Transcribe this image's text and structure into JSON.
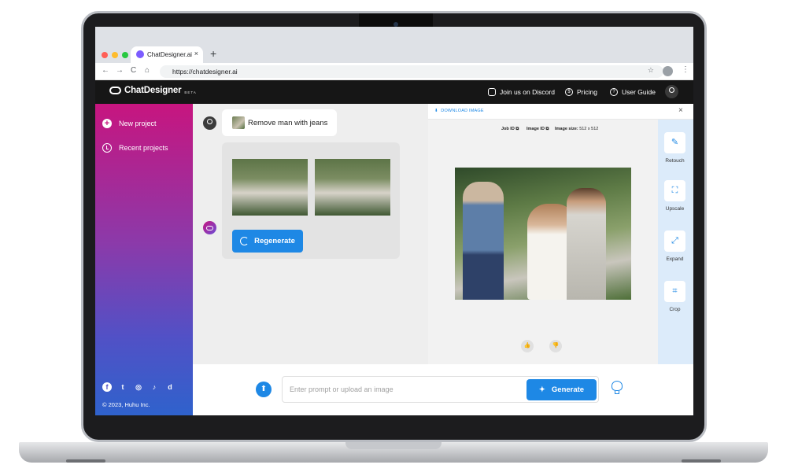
{
  "browser": {
    "tab_title": "ChatDesigner.ai",
    "tab_close": "×",
    "new_tab": "+",
    "url": "https://chatdesigner.ai",
    "back": "←",
    "forward": "→",
    "reload": "C",
    "home": "⌂",
    "bookmark": "☆",
    "menu": "⋮"
  },
  "header": {
    "brand": "ChatDesigner",
    "badge": "BETA",
    "discord": "Join us on Discord",
    "pricing": "Pricing",
    "user_guide": "User Guide",
    "pricing_icon": "$",
    "guide_icon": "?"
  },
  "sidebar": {
    "new_project": "New project",
    "new_project_icon": "+",
    "recent_projects": "Recent projects",
    "social": [
      {
        "name": "facebook",
        "glyph": "f"
      },
      {
        "name": "twitter",
        "glyph": "t"
      },
      {
        "name": "instagram",
        "glyph": "◎"
      },
      {
        "name": "tiktok",
        "glyph": "♪"
      },
      {
        "name": "discord",
        "glyph": "d"
      }
    ],
    "copyright": "© 2023, Huhu Inc."
  },
  "chat": {
    "prompt": "Remove man with jeans",
    "regenerate": "Regenerate"
  },
  "panel": {
    "download": "DOWNLOAD IMAGE",
    "download_icon": "⬇",
    "close": "×",
    "job_id_label": "Job ID",
    "image_id_label": "Image ID",
    "image_size_label": "Image size:",
    "image_size_value": "512 x 512",
    "copy_icon": "⧉",
    "like": "👍",
    "dislike": "👎"
  },
  "tools": [
    {
      "label": "Retouch",
      "glyph": "✎"
    },
    {
      "label": "Upscale",
      "glyph": "⛶"
    },
    {
      "label": "Expand",
      "glyph": "⤢"
    },
    {
      "label": "Crop",
      "glyph": "⌗"
    }
  ],
  "composer": {
    "placeholder": "Enter prompt or upload an image",
    "upload_icon": "⬆",
    "generate": "Generate",
    "generate_icon": "✦"
  },
  "colors": {
    "accent": "#1e88e5",
    "sidebar_top": "#c7157f",
    "sidebar_bottom": "#2f62cc",
    "header_bg": "#161616"
  }
}
